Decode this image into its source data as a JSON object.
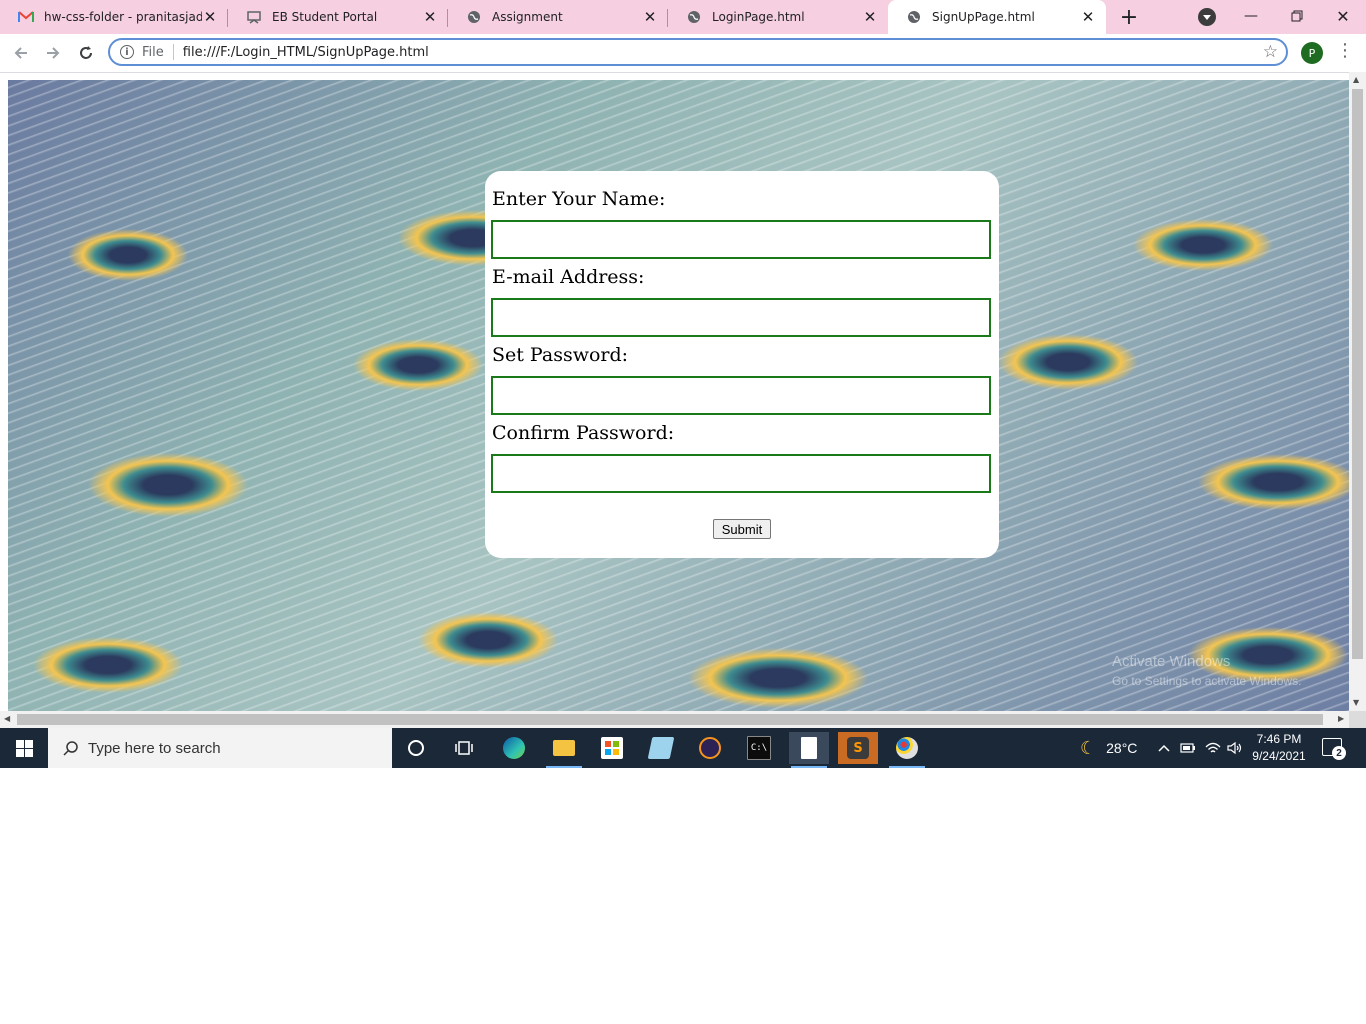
{
  "browser": {
    "tabs": [
      {
        "title": "hw-css-folder - pranitasjadha",
        "icon": "gmail-icon",
        "active": false
      },
      {
        "title": "EB Student Portal",
        "icon": "portal-icon",
        "active": false
      },
      {
        "title": "Assignment",
        "icon": "globe-icon",
        "active": false
      },
      {
        "title": "LoginPage.html",
        "icon": "globe-icon",
        "active": false
      },
      {
        "title": "SignUpPage.html",
        "icon": "globe-icon",
        "active": true
      }
    ],
    "address": {
      "scheme": "File",
      "url": "file:///F:/Login_HTML/SignUpPage.html"
    },
    "profile_initial": "P",
    "colors": {
      "tabstrip": "#f6cfe0",
      "omnibox_border": "#5e8fd6",
      "profile": "#1e6b22"
    }
  },
  "form": {
    "name_label": "Enter Your Name:",
    "email_label": "E-mail Address:",
    "password_label": "Set Password:",
    "confirm_label": "Confirm Password:",
    "submit_label": "Submit",
    "name_value": "",
    "email_value": "",
    "password_value": "",
    "confirm_value": "",
    "input_border_color": "#1a7a1a"
  },
  "watermark": {
    "line1": "Activate Windows",
    "line2": "Go to Settings to activate Windows."
  },
  "taskbar": {
    "search_placeholder": "Type here to search",
    "weather": "28°C",
    "time": "7:46 PM",
    "date": "9/24/2021",
    "notification_count": "2",
    "apps": [
      "cortana-icon",
      "task-view-icon",
      "edge-icon",
      "file-explorer-icon",
      "store-icon",
      "notepad-icon",
      "eclipse-icon",
      "terminal-icon",
      "file-icon",
      "sublime-icon",
      "paint-icon"
    ]
  }
}
